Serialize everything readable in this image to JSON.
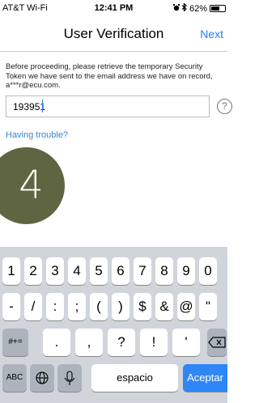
{
  "status_bar": {
    "carrier": "AT&T Wi-Fi",
    "time": "12:41 PM",
    "battery": "62%",
    "battery_level": 0.62
  },
  "nav": {
    "title": "User Verification",
    "next_label": "Next"
  },
  "form": {
    "instructions": "Before proceeding, please retrieve the temporary Security Token we have sent to the email address we have on record, a***r@ecu.com.",
    "token_value": "193951",
    "help_glyph": "?",
    "trouble_link": "Having trouble?"
  },
  "overlay": {
    "step_number": "4"
  },
  "keyboard": {
    "row1": [
      "1",
      "2",
      "3",
      "4",
      "5",
      "6",
      "7",
      "8",
      "9",
      "0"
    ],
    "row2": [
      "-",
      "/",
      ":",
      ";",
      "(",
      ")",
      "$",
      "&",
      "@",
      "\""
    ],
    "symbols_key": "#+=",
    "row3": [
      ".",
      ",",
      "?",
      "!",
      "'"
    ],
    "abc_key": "ABC",
    "space_label": "espacio",
    "return_label": "Aceptar"
  }
}
